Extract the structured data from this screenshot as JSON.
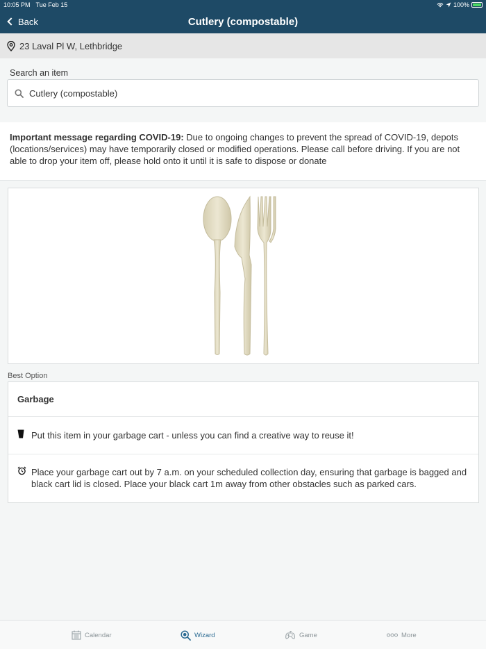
{
  "status": {
    "time": "10:05 PM",
    "date": "Tue Feb 15",
    "battery": "100%"
  },
  "nav": {
    "back_label": "Back",
    "title": "Cutlery (compostable)"
  },
  "location": {
    "address": "23 Laval Pl W, Lethbridge"
  },
  "search": {
    "label": "Search an item",
    "value": "Cutlery (compostable)"
  },
  "covid": {
    "heading": "Important message regarding COVID-19:",
    "body": " Due to ongoing changes to prevent the spread of COVID-19, depots (locations/services) may have temporarily closed or modified operations. Please call before driving. If you are not able to drop your item off, please hold onto it until it is safe to dispose or donate"
  },
  "best_option": {
    "label": "Best Option",
    "title": "Garbage",
    "instruction_1": "Put this item in your garbage cart - unless you can find a creative way to reuse it!",
    "instruction_2": "Place your garbage cart out by 7 a.m. on your scheduled collection day, ensuring that garbage is bagged and black cart lid is closed. Place your black cart 1m away from other obstacles such as parked cars."
  },
  "tabs": [
    {
      "label": "Calendar",
      "icon": "calendar-icon"
    },
    {
      "label": "Wizard",
      "icon": "wizard-search-icon",
      "active": true
    },
    {
      "label": "Game",
      "icon": "game-icon"
    },
    {
      "label": "More",
      "icon": "more-icon"
    }
  ],
  "colors": {
    "header": "#1e4a66",
    "accent": "#2a6a92",
    "cutlery": "#e2dcc2"
  }
}
